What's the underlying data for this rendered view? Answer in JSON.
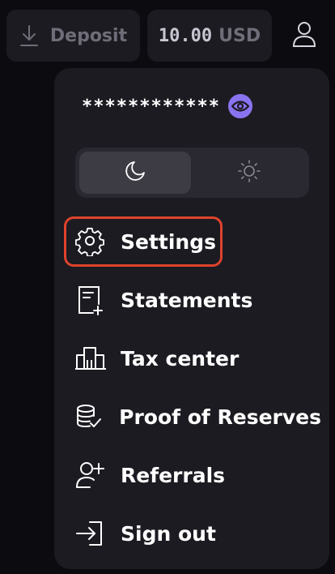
{
  "header": {
    "deposit_label": "Deposit",
    "deposit_icon": "download-icon",
    "balance_amount": "10.00",
    "balance_currency": "USD",
    "user_icon": "user-icon"
  },
  "menu": {
    "masked_value": "************",
    "eye_icon": "eye-icon",
    "theme": {
      "options": [
        "dark",
        "light"
      ],
      "selected": "dark"
    },
    "items": [
      {
        "label": "Settings",
        "icon": "gear-icon",
        "highlighted": true
      },
      {
        "label": "Statements",
        "icon": "document-add-icon"
      },
      {
        "label": "Tax center",
        "icon": "building-icon"
      },
      {
        "label": "Proof of Reserves",
        "icon": "database-check-icon"
      },
      {
        "label": "Referrals",
        "icon": "user-add-icon"
      },
      {
        "label": "Sign out",
        "icon": "sign-out-icon"
      }
    ]
  },
  "colors": {
    "background": "#0c0b10",
    "panel": "#1c1b22",
    "accent": "#8a73f0",
    "highlight_border": "#e0432c"
  }
}
